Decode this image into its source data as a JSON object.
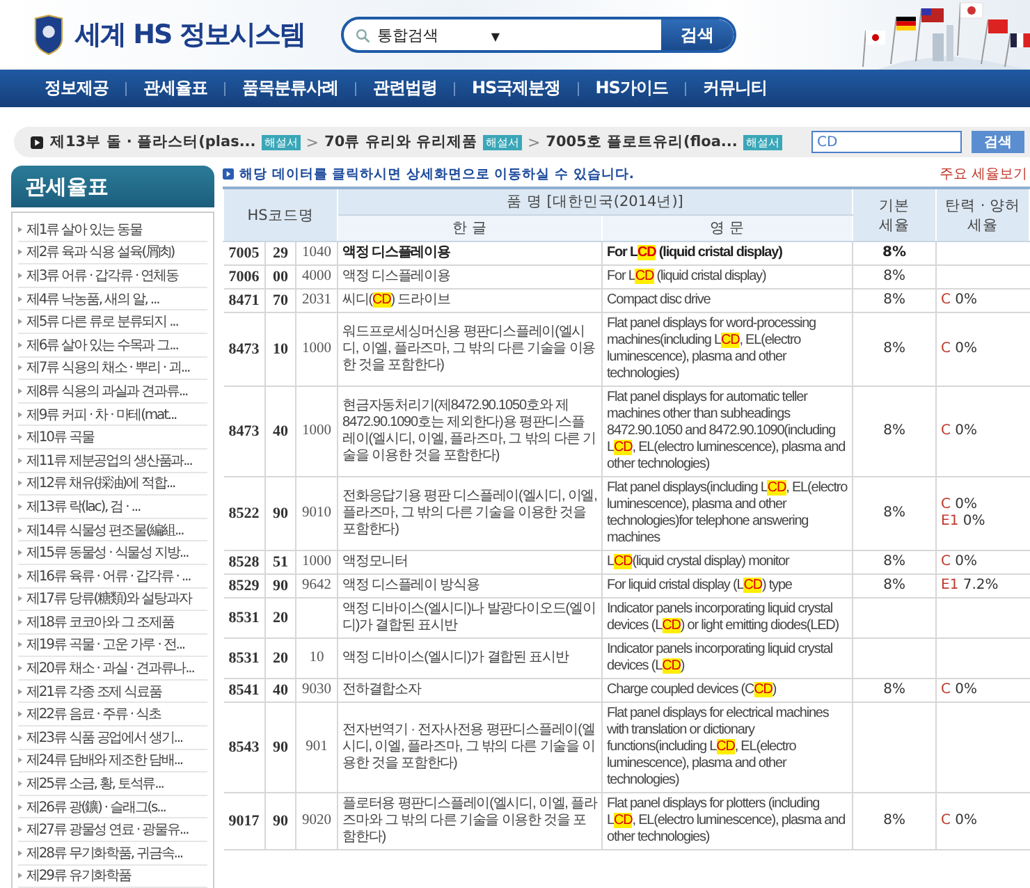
{
  "header": {
    "title": "세계 HS 정보시스템",
    "search": {
      "scope": "통합검색",
      "caret": "▼",
      "button": "검색"
    }
  },
  "nav": [
    "정보제공",
    "관세율표",
    "품목분류사례",
    "관련법령",
    "HS국제분쟁",
    "HS가이드",
    "커뮤니티"
  ],
  "breadcrumb": {
    "crumbs": [
      {
        "label": "제13부 돌 · 플라스터(plas...",
        "badge": "해설서"
      },
      {
        "label": "70류 유리와 유리제품",
        "badge": "해설서"
      },
      {
        "label": "7005호 플로트유리(floa...",
        "badge": "해설서"
      }
    ],
    "separator": ">",
    "search": {
      "value": "CD",
      "button": "검색"
    }
  },
  "sidebar": {
    "title": "관세율표",
    "items": [
      "제1류 살아 있는 동물",
      "제2류 육과 식용 설육(屑肉)",
      "제3류 어류 · 갑각류 · 연체동",
      "제4류 낙농품, 새의 알, ...",
      "제5류 다른 류로 분류되지 ...",
      "제6류 살아 있는 수목과 그...",
      "제7류 식용의 채소 · 뿌리 · 괴...",
      "제8류 식용의 과실과 견과류...",
      "제9류 커피 · 차 · 마테(mat...",
      "제10류 곡물",
      "제11류 제분공업의 생산품과...",
      "제12류 채유(採油)에 적합...",
      "제13류 락(lac), 검 · ...",
      "제14류 식물성 편조물(編組...",
      "제15류 동물성 · 식물성 지방...",
      "제16류 육류 · 어류 · 갑각류 · ...",
      "제17류 당류(糖類)와 설탕과자",
      "제18류 코코아와 그 조제품",
      "제19류 곡물 · 고운 가루 · 전...",
      "제20류 채소 · 과실 · 견과류나...",
      "제21류 각종 조제 식료품",
      "제22류 음료 · 주류 · 식초",
      "제23류 식품 공업에서 생기...",
      "제24류 담배와 제조한 담배...",
      "제25류 소금, 황, 토석류...",
      "제26류 광(鑛) · 슬래그(s...",
      "제27류 광물성 연료 · 광물유...",
      "제28류 무기화학품, 귀금속...",
      "제29류 유기화학품"
    ]
  },
  "notice": "해당 데이터를 클릭하시면 상세화면으로 이동하실 수 있습니다.",
  "rates_link": "주요 세율보기",
  "table": {
    "columns": {
      "code": "HS코드명",
      "name": "품 명 [대한민국(2014년)]",
      "korean": "한 글",
      "english": "영 문",
      "basic": "기본\n세율",
      "flex": "탄력 · 양허\n세율"
    },
    "rows": [
      {
        "bold": true,
        "code": [
          "7005",
          "29",
          "1040"
        ],
        "korean": [
          {
            "text": "액정 디스플레이용",
            "highlight": false
          }
        ],
        "english": [
          {
            "text": "For L",
            "highlight": false
          },
          {
            "text": "CD",
            "highlight": true
          },
          {
            "text": " (liquid cristal display)",
            "highlight": false
          }
        ],
        "basic": "8%",
        "rates": []
      },
      {
        "bold": false,
        "code": [
          "7006",
          "00",
          "4000"
        ],
        "korean": [
          {
            "text": "액정 디스플레이용",
            "highlight": false
          }
        ],
        "english": [
          {
            "text": "For L",
            "highlight": false
          },
          {
            "text": "CD",
            "highlight": true
          },
          {
            "text": " (liquid cristal display)",
            "highlight": false
          }
        ],
        "basic": "8%",
        "rates": []
      },
      {
        "bold": false,
        "code": [
          "8471",
          "70",
          "2031"
        ],
        "korean": [
          {
            "text": "씨디(",
            "highlight": false
          },
          {
            "text": "CD",
            "highlight": true
          },
          {
            "text": ") 드라이브",
            "highlight": false
          }
        ],
        "english": [
          {
            "text": "Compact disc drive",
            "highlight": false
          }
        ],
        "basic": "8%",
        "rates": [
          {
            "code": "C",
            "rate": "0%"
          }
        ]
      },
      {
        "bold": false,
        "code": [
          "8473",
          "10",
          "1000"
        ],
        "korean": [
          {
            "text": "워드프로세싱머신용 평판디스플레이(엘시디, 이엘, 플라즈마, 그 밖의 다른 기술을 이용한 것을 포함한다)",
            "highlight": false
          }
        ],
        "english": [
          {
            "text": "Flat panel displays for word-processing machines(including L",
            "highlight": false
          },
          {
            "text": "CD",
            "highlight": true
          },
          {
            "text": ", EL(electro luminescence), plasma and other technologies)",
            "highlight": false
          }
        ],
        "basic": "8%",
        "rates": [
          {
            "code": "C",
            "rate": "0%"
          }
        ]
      },
      {
        "bold": false,
        "code": [
          "8473",
          "40",
          "1000"
        ],
        "korean": [
          {
            "text": "현금자동처리기(제8472.90.1050호와 제8472.90.1090호는 제외한다)용 평판디스플레이(엘시디, 이엘, 플라즈마, 그 밖의 다른 기술을 이용한 것을 포함한다)",
            "highlight": false
          }
        ],
        "english": [
          {
            "text": "Flat panel displays for automatic teller machines other than subheadings 8472.90.1050 and 8472.90.1090(including L",
            "highlight": false
          },
          {
            "text": "CD",
            "highlight": true
          },
          {
            "text": ", EL(electro luminescence), plasma and other technologies)",
            "highlight": false
          }
        ],
        "basic": "8%",
        "rates": [
          {
            "code": "C",
            "rate": "0%"
          }
        ]
      },
      {
        "bold": false,
        "code": [
          "8522",
          "90",
          "9010"
        ],
        "korean": [
          {
            "text": "전화응답기용 평판 디스플레이(엘시디, 이엘, 플라즈마, 그 밖의 다른 기술을 이용한 것을 포함한다)",
            "highlight": false
          }
        ],
        "english": [
          {
            "text": "Flat panel displays(including L",
            "highlight": false
          },
          {
            "text": "CD",
            "highlight": true
          },
          {
            "text": ", EL(electro luminescence), plasma and other technologies)for telephone answering machines",
            "highlight": false
          }
        ],
        "basic": "8%",
        "rates": [
          {
            "code": "C",
            "rate": "0%"
          },
          {
            "code": "E1",
            "rate": "0%"
          }
        ]
      },
      {
        "bold": false,
        "code": [
          "8528",
          "51",
          "1000"
        ],
        "korean": [
          {
            "text": "액정모니터",
            "highlight": false
          }
        ],
        "english": [
          {
            "text": "L",
            "highlight": false
          },
          {
            "text": "CD",
            "highlight": true
          },
          {
            "text": "(liquid crystal display) monitor",
            "highlight": false
          }
        ],
        "basic": "8%",
        "rates": [
          {
            "code": "C",
            "rate": "0%"
          }
        ]
      },
      {
        "bold": false,
        "code": [
          "8529",
          "90",
          "9642"
        ],
        "korean": [
          {
            "text": "액정 디스플레이 방식용",
            "highlight": false
          }
        ],
        "english": [
          {
            "text": "For liquid cristal display (L",
            "highlight": false
          },
          {
            "text": "CD",
            "highlight": true
          },
          {
            "text": ") type",
            "highlight": false
          }
        ],
        "basic": "8%",
        "rates": [
          {
            "code": "E1",
            "rate": "7.2%"
          }
        ]
      },
      {
        "bold": false,
        "code": [
          "8531",
          "20"
        ],
        "korean": [
          {
            "text": "액정 디바이스(엘시디)나 발광다이오드(엘이디)가 결합된 표시반",
            "highlight": false
          }
        ],
        "english": [
          {
            "text": "Indicator panels incorporating liquid crystal devices (L",
            "highlight": false
          },
          {
            "text": "CD",
            "highlight": true
          },
          {
            "text": ") or light emitting diodes(LED)",
            "highlight": false
          }
        ],
        "rates": []
      },
      {
        "bold": false,
        "code": [
          "8531",
          "20",
          "10"
        ],
        "korean": [
          {
            "text": "액정 디바이스(엘시디)가 결합된 표시반",
            "highlight": false
          }
        ],
        "english": [
          {
            "text": "Indicator panels incorporating liquid crystal devices (L",
            "highlight": false
          },
          {
            "text": "CD",
            "highlight": true
          },
          {
            "text": ")",
            "highlight": false
          }
        ],
        "rates": []
      },
      {
        "bold": false,
        "code": [
          "8541",
          "40",
          "9030"
        ],
        "korean": [
          {
            "text": "전하결합소자",
            "highlight": false
          }
        ],
        "english": [
          {
            "text": "Charge coupled devices (C",
            "highlight": false
          },
          {
            "text": "CD",
            "highlight": true
          },
          {
            "text": ")",
            "highlight": false
          }
        ],
        "basic": "8%",
        "rates": [
          {
            "code": "C",
            "rate": "0%"
          }
        ]
      },
      {
        "bold": false,
        "code": [
          "8543",
          "90",
          "901"
        ],
        "korean": [
          {
            "text": "전자번역기 · 전자사전용 평판디스플레이(엘시디, 이엘, 플라즈마, 그 밖의 다른 기술을 이용한 것을 포함한다)",
            "highlight": false
          }
        ],
        "english": [
          {
            "text": "Flat panel displays for electrical machines with translation or dictionary functions(including L",
            "highlight": false
          },
          {
            "text": "CD",
            "highlight": true
          },
          {
            "text": ", EL(electro luminescence), plasma and other technologies)",
            "highlight": false
          }
        ],
        "rates": []
      },
      {
        "bold": false,
        "code": [
          "9017",
          "90",
          "9020"
        ],
        "korean": [
          {
            "text": "플로터용 평판디스플레이(엘시디, 이엘, 플라즈마와 그 밖의 다른 기술을 이용한 것을 포함한다)",
            "highlight": false
          }
        ],
        "english": [
          {
            "text": "Flat panel displays for plotters (including L",
            "highlight": false
          },
          {
            "text": "CD",
            "highlight": true
          },
          {
            "text": ", EL(electro luminescence), plasma and other technologies)",
            "highlight": false
          }
        ],
        "basic": "8%",
        "rates": [
          {
            "code": "C",
            "rate": "0%"
          }
        ]
      }
    ]
  }
}
